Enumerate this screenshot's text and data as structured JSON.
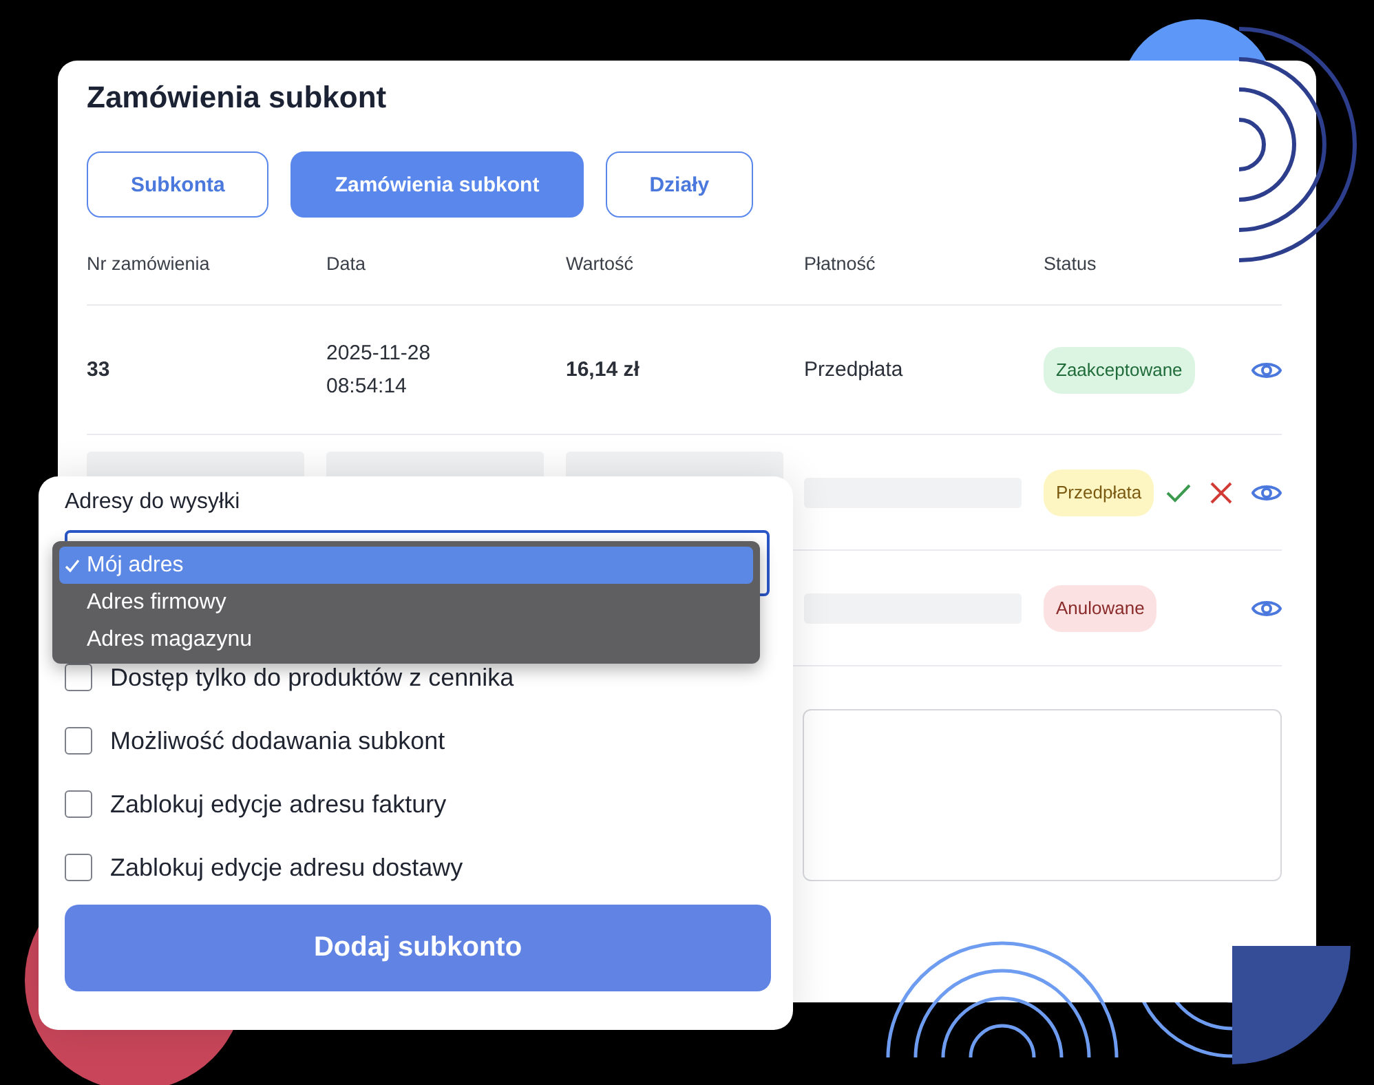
{
  "orders_panel": {
    "title": "Zamówienia subkont",
    "tabs": [
      {
        "label": "Subkonta",
        "selected": false
      },
      {
        "label": "Zamówienia subkont",
        "selected": true
      },
      {
        "label": "Działy",
        "selected": false
      }
    ],
    "table": {
      "columns": [
        "Nr zamówienia",
        "Data",
        "Wartość",
        "Płatność",
        "Status"
      ],
      "rows": [
        {
          "kind": "data",
          "cells": [
            "33",
            "2025-11-28\n08:54:14",
            "16,14 zł",
            "Przedpłata"
          ],
          "status": {
            "label": "Zaakceptowane",
            "kind": "success"
          },
          "pending_actions": false
        },
        {
          "kind": "placeholder",
          "status": {
            "label": "Przedpłata",
            "kind": "warning"
          },
          "pending_actions": true
        },
        {
          "kind": "placeholder",
          "status": {
            "label": "Anulowane",
            "kind": "danger"
          },
          "pending_actions": false
        }
      ]
    }
  },
  "subaccount_form": {
    "address_label": "Adresy do wysyłki",
    "address_options": [
      {
        "label": "Mój adres",
        "selected": true
      },
      {
        "label": "Adres firmowy",
        "selected": false
      },
      {
        "label": "Adres magazynu",
        "selected": false
      }
    ],
    "checkboxes": [
      {
        "label": "Dostęp tylko do produktów z cennika",
        "checked": false
      },
      {
        "label": "Możliwość dodawania subkont",
        "checked": false
      },
      {
        "label": "Zablokuj edycje adresu faktury",
        "checked": false
      },
      {
        "label": "Zablokuj edycje adresu dostawy",
        "checked": false
      }
    ],
    "submit": "Dodaj subkonto"
  }
}
